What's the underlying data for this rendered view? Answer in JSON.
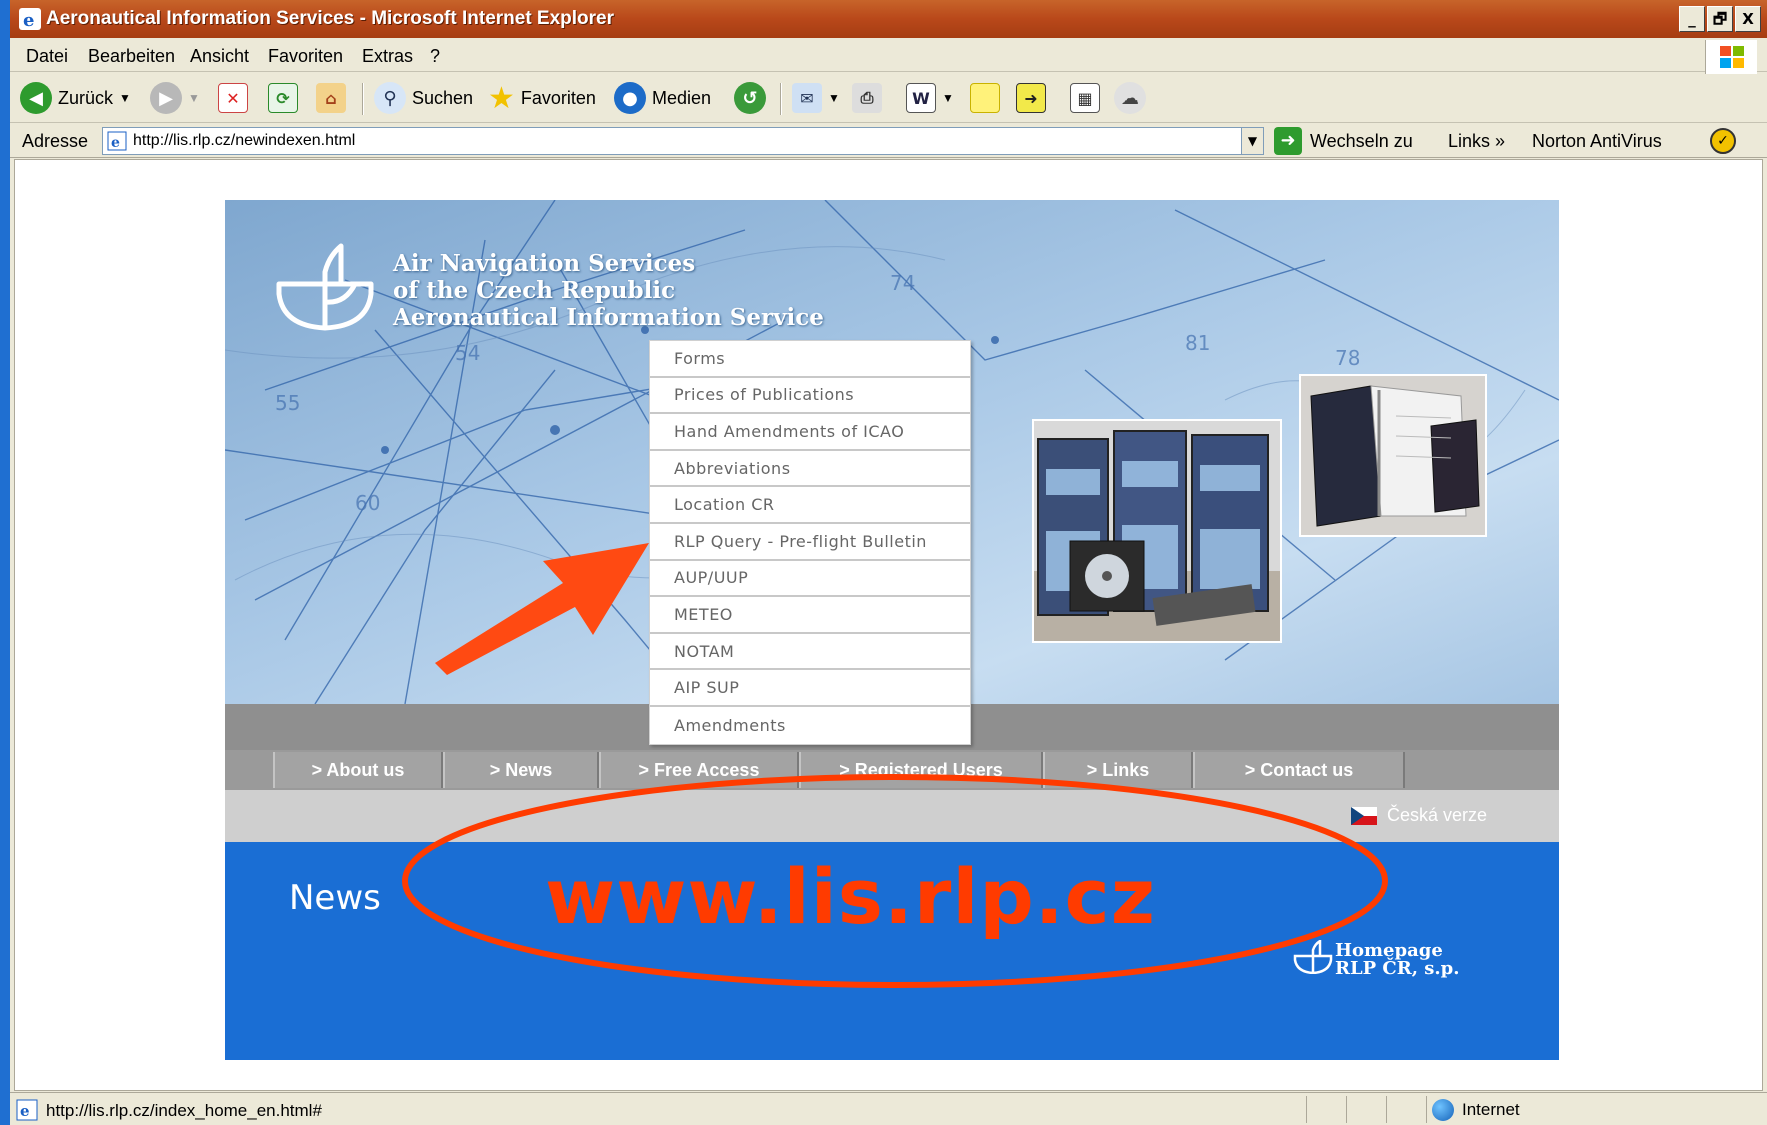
{
  "window": {
    "title": "Aeronautical Information Services - Microsoft Internet Explorer",
    "controls": [
      "_",
      "🗗",
      "X"
    ]
  },
  "menubar": {
    "items": [
      "Datei",
      "Bearbeiten",
      "Ansicht",
      "Favoriten",
      "Extras",
      "?"
    ]
  },
  "toolbar": {
    "back_label": "Zurück",
    "search_label": "Suchen",
    "favorites_label": "Favoriten",
    "media_label": "Medien"
  },
  "addressbar": {
    "label": "Adresse",
    "url": "http://lis.rlp.cz/newindexen.html",
    "go_label": "Wechseln zu",
    "links_label": "Links »",
    "norton_label": "Norton AntiVirus"
  },
  "site": {
    "org_line1": "Air Navigation Services",
    "org_line2": "of the Czech Republic",
    "org_line3": "Aeronautical Information Service",
    "dropdown": [
      "Forms",
      "Prices of Publications",
      "Hand Amendments of ICAO",
      "Abbreviations",
      "Location CR",
      "RLP Query - Pre-flight Bulletin",
      "AUP/UUP",
      "METEO",
      "NOTAM",
      "AIP SUP",
      "Amendments"
    ],
    "nav": [
      "> About us",
      "> News",
      "> Free Access",
      "> Registered Users",
      "> Links",
      "> Contact us"
    ],
    "czech_version": "Česká verze",
    "news_label": "News",
    "homepage_line1": "Homepage",
    "homepage_line2": "RLP ČR, s.p.",
    "annotation_url": "www.lis.rlp.cz",
    "colors": {
      "annotation": "#ff3b00",
      "news_band": "#1a6ed4"
    }
  },
  "statusbar": {
    "text": "http://lis.rlp.cz/index_home_en.html#",
    "zone": "Internet"
  }
}
